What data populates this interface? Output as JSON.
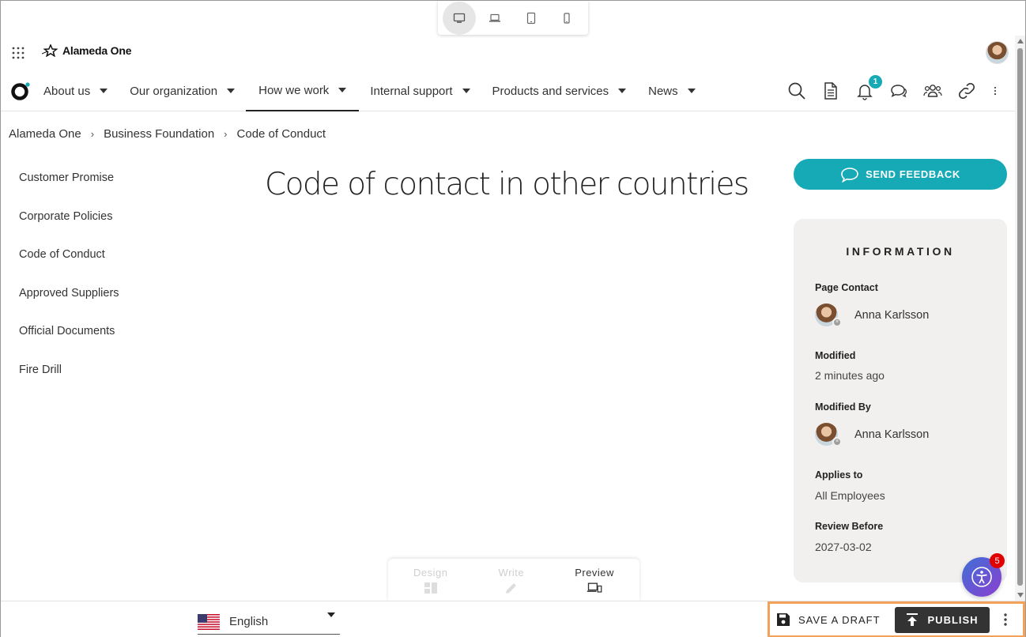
{
  "device_switcher": {
    "options": [
      {
        "icon": "desktop-icon",
        "active": true
      },
      {
        "icon": "laptop-icon",
        "active": false
      },
      {
        "icon": "tablet-icon",
        "active": false
      },
      {
        "icon": "phone-icon",
        "active": false
      }
    ]
  },
  "header": {
    "app_grid_icon": "grid-icon",
    "brand_name": "Alameda One",
    "user_avatar": "avatar"
  },
  "nav": {
    "logo_icon": "alameda-logo-icon",
    "items": [
      {
        "label": "About us",
        "active": false
      },
      {
        "label": "Our organization",
        "active": false
      },
      {
        "label": "How we work",
        "active": true
      },
      {
        "label": "Internal support",
        "active": false
      },
      {
        "label": "Products and services",
        "active": false
      },
      {
        "label": "News",
        "active": false
      }
    ],
    "tools": [
      "search-icon",
      "document-icon",
      "bell-icon",
      "chat-icon",
      "people-icon",
      "link-icon",
      "more-vertical-icon"
    ],
    "notification_count": "1"
  },
  "breadcrumb": [
    "Alameda One",
    "Business Foundation",
    "Code of Conduct"
  ],
  "breadcrumb_separator": "›",
  "subnav": {
    "items": [
      "Customer Promise",
      "Corporate Policies",
      "Code of Conduct",
      "Approved Suppliers",
      "Official Documents",
      "Fire Drill"
    ]
  },
  "page": {
    "title": "Code of contact in other countries"
  },
  "feedback": {
    "label": "SEND FEEDBACK",
    "color": "#16a9b6"
  },
  "info": {
    "heading": "INFORMATION",
    "page_contact_label": "Page Contact",
    "page_contact_name": "Anna Karlsson",
    "modified_label": "Modified",
    "modified_value": "2 minutes ago",
    "modified_by_label": "Modified By",
    "modified_by_name": "Anna Karlsson",
    "applies_to_label": "Applies to",
    "applies_to_value": "All Employees",
    "review_before_label": "Review Before",
    "review_before_value": "2027-03-02"
  },
  "accessibility": {
    "badge_count": "5"
  },
  "modes": [
    {
      "label": "Design",
      "icon": "layout-icon",
      "enabled": false
    },
    {
      "label": "Write",
      "icon": "pencil-icon",
      "enabled": false
    },
    {
      "label": "Preview",
      "icon": "devices-icon",
      "enabled": true
    }
  ],
  "bottom": {
    "language": "English",
    "flag_icon": "us-flag-icon",
    "save_draft_label": "SAVE A DRAFT",
    "publish_label": "PUBLISH",
    "highlight_color": "#f4a25a"
  }
}
